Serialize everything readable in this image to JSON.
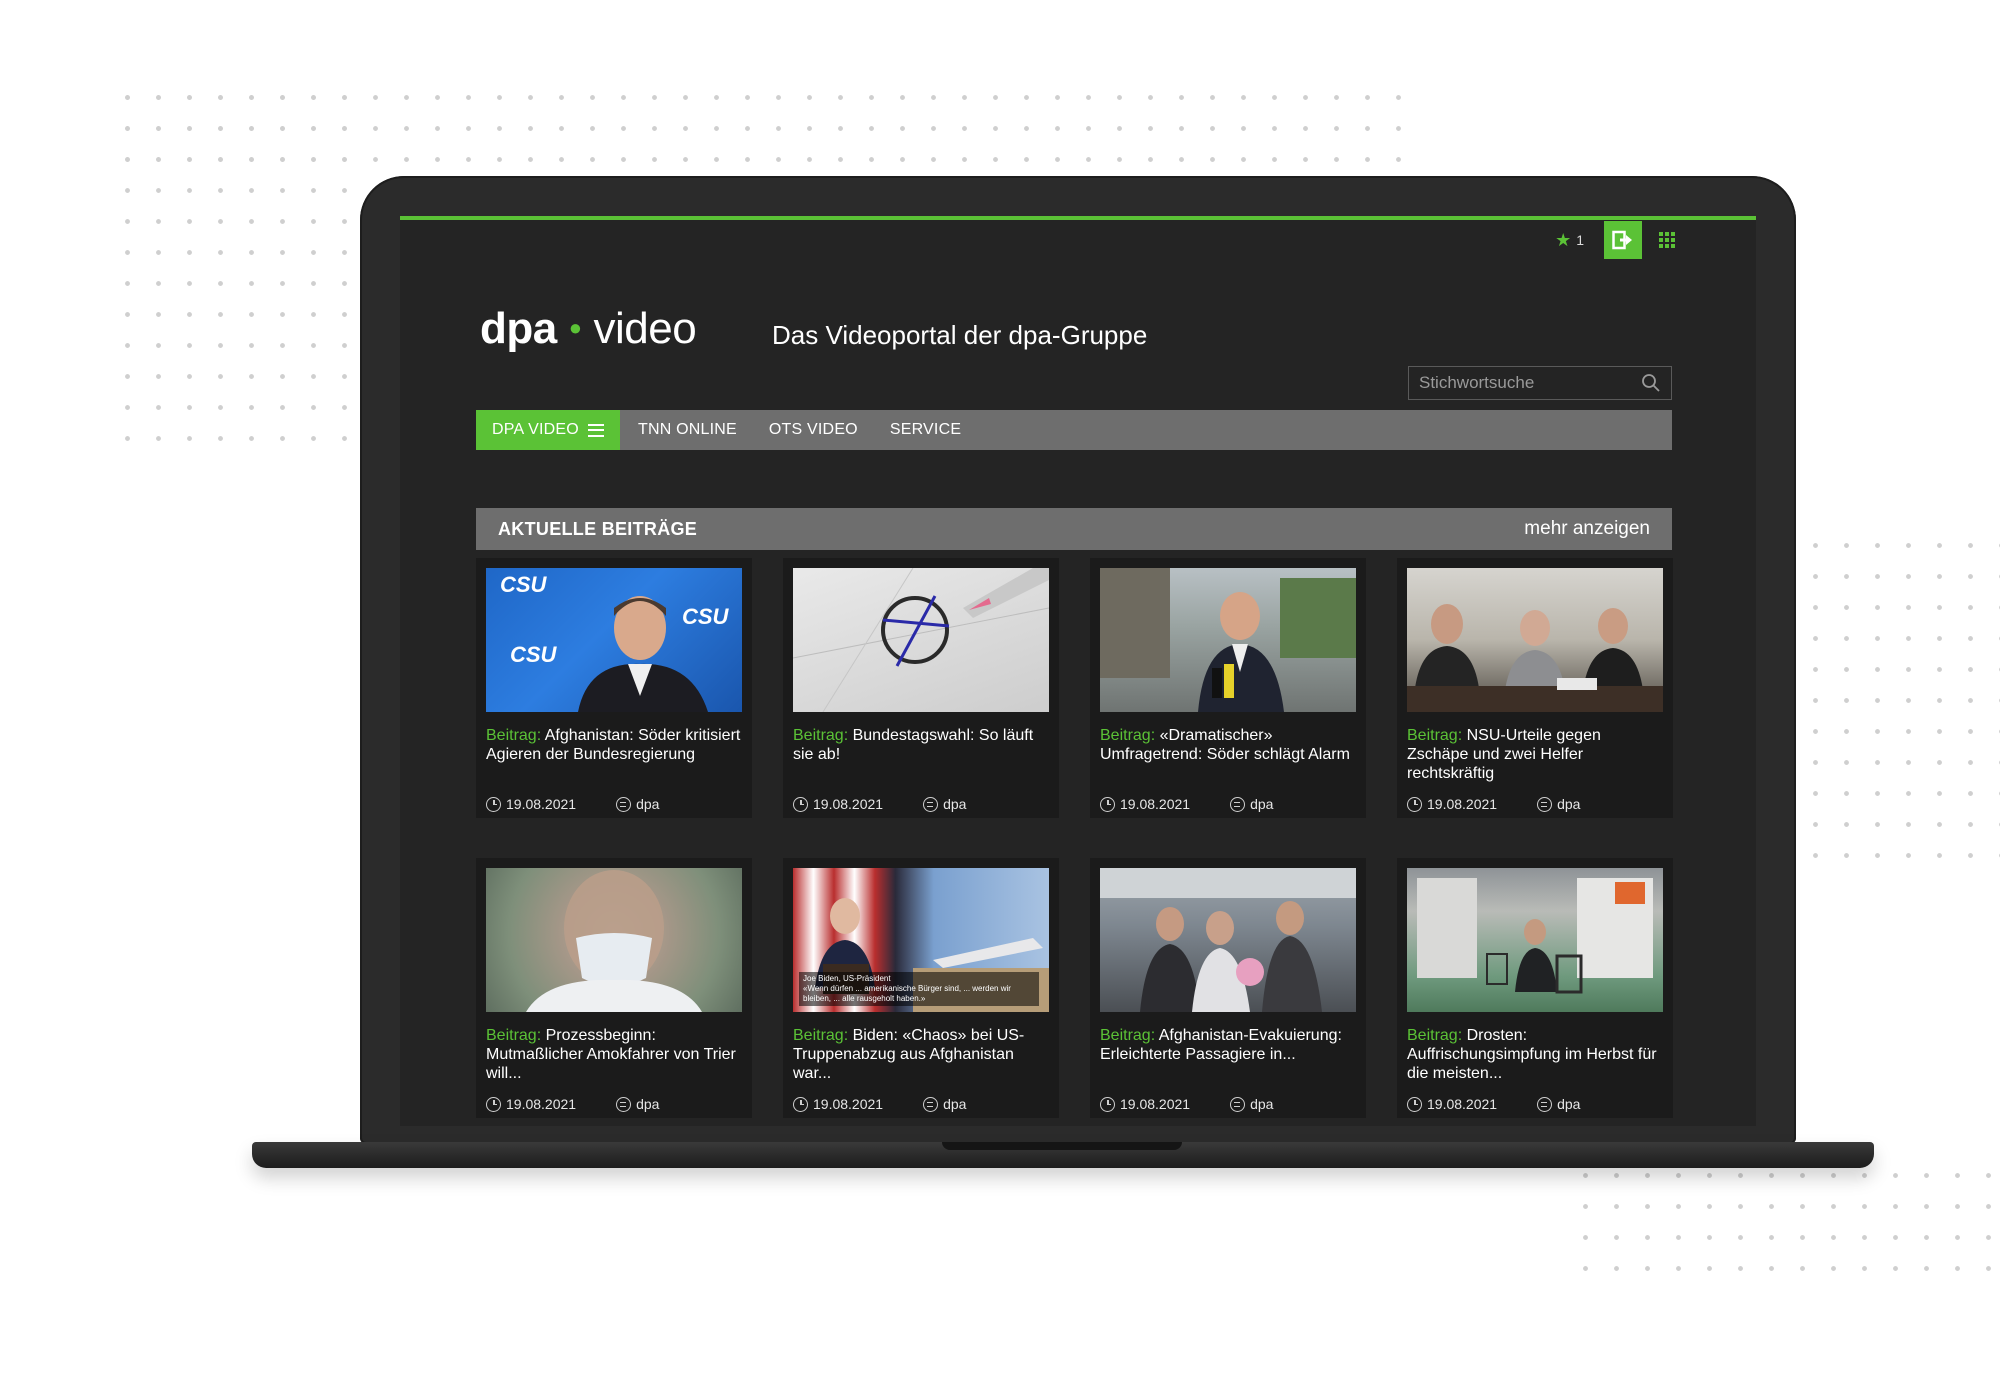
{
  "topbar": {
    "favorites_count": "1"
  },
  "header": {
    "logo_left": "dpa",
    "logo_right": "video",
    "tagline": "Das Videoportal der dpa-Gruppe"
  },
  "search": {
    "placeholder": "Stichwortsuche"
  },
  "nav": {
    "items": [
      {
        "label": "DPA VIDEO"
      },
      {
        "label": "TNN ONLINE"
      },
      {
        "label": "OTS VIDEO"
      },
      {
        "label": "SERVICE"
      }
    ]
  },
  "section": {
    "title": "AKTUELLE BEITRÄGE",
    "more": "mehr anzeigen"
  },
  "cards": [
    {
      "kind": "Beitrag:",
      "title": "Afghanistan: Söder kritisiert Agieren der Bundesregierung",
      "date": "19.08.2021",
      "source": "dpa"
    },
    {
      "kind": "Beitrag:",
      "title": "Bundestagswahl: So läuft sie ab!",
      "date": "19.08.2021",
      "source": "dpa"
    },
    {
      "kind": "Beitrag:",
      "title": "«Dramatischer» Umfragetrend: Söder schlägt Alarm",
      "date": "19.08.2021",
      "source": "dpa"
    },
    {
      "kind": "Beitrag:",
      "title": "NSU-Urteile gegen Zschäpe und zwei Helfer rechtskräftig",
      "date": "19.08.2021",
      "source": "dpa"
    },
    {
      "kind": "Beitrag:",
      "title": "Prozessbeginn: Mutmaßlicher Amokfahrer von Trier will...",
      "date": "19.08.2021",
      "source": "dpa"
    },
    {
      "kind": "Beitrag:",
      "title": "Biden: «Chaos» bei US-Truppenabzug aus Afghanistan war...",
      "date": "19.08.2021",
      "source": "dpa"
    },
    {
      "kind": "Beitrag:",
      "title": "Afghanistan-Evakuierung: Erleichterte Passagiere in...",
      "date": "19.08.2021",
      "source": "dpa"
    },
    {
      "kind": "Beitrag:",
      "title": "Drosten: Auffrischungsimpfung im Herbst für die meisten...",
      "date": "19.08.2021",
      "source": "dpa"
    }
  ],
  "thumbnails": {
    "csu_text": "CSU",
    "biden_caption_name": "Joe Biden, US-Präsident",
    "biden_caption_quote": "«Wenn dürfen ... amerikanische Bürger sind, ... werden wir bleiben, ... alle rausgeholt haben.»"
  },
  "colors": {
    "accent": "#5bc236",
    "screen_bg": "#242424",
    "bar_gray": "#6e6e6e"
  },
  "icons": {
    "favorite": "star-icon",
    "logout": "exit-icon",
    "apps": "grid-icon",
    "search": "search-icon",
    "menu": "hamburger-icon",
    "date": "clock-icon",
    "source": "source-icon"
  }
}
